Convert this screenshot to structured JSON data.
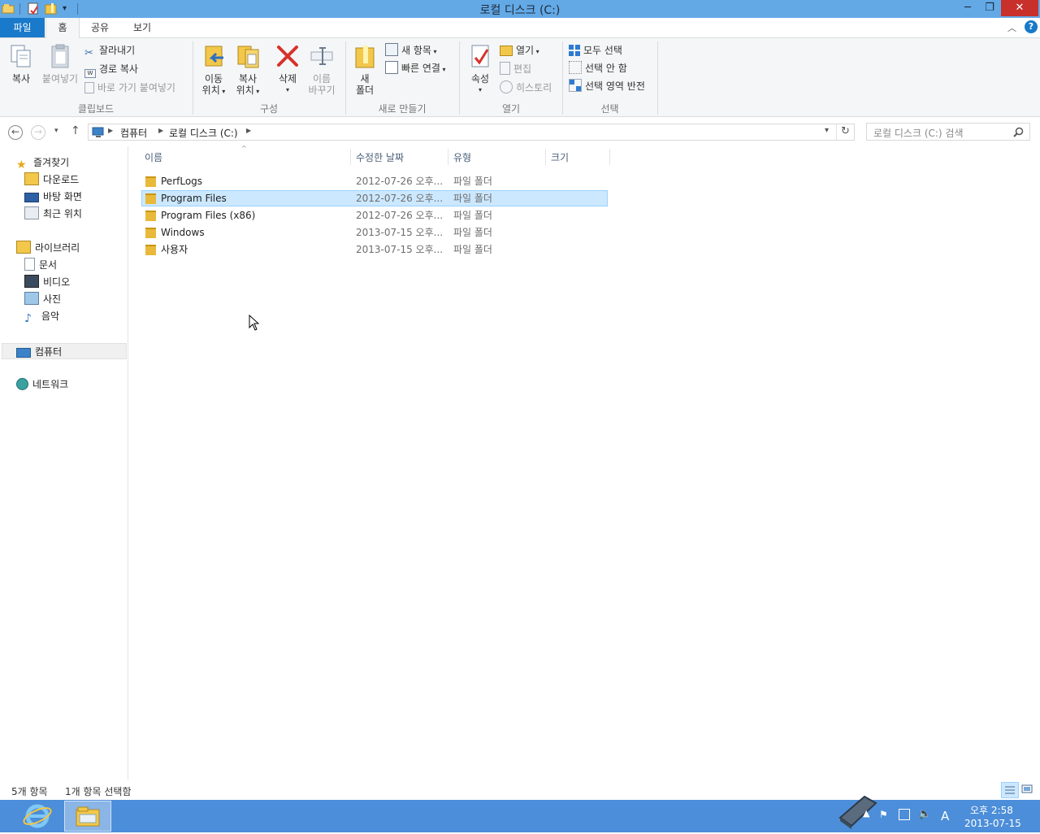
{
  "window": {
    "title": "로컬 디스크 (C:)",
    "minimize": "─",
    "restore": "❐",
    "close": "✕"
  },
  "tabs": [
    "파일",
    "홈",
    "공유",
    "보기"
  ],
  "ribbon": {
    "clipboard": {
      "label": "클립보드",
      "copy": "복사",
      "paste": "붙여넣기",
      "cut": "잘라내기",
      "copy_path": "경로 복사",
      "paste_shortcut": "바로 가기 붙여넣기"
    },
    "organize": {
      "label": "구성",
      "move_to_1": "이동",
      "move_to_2": "위치",
      "copy_to_1": "복사",
      "copy_to_2": "위치",
      "delete": "삭제",
      "rename_1": "이름",
      "rename_2": "바꾸기"
    },
    "new": {
      "label": "새로 만들기",
      "new_folder_1": "새",
      "new_folder_2": "폴더",
      "new_item": "새 항목",
      "easy_access": "빠른 연결"
    },
    "open": {
      "label": "열기",
      "properties": "속성",
      "open": "열기",
      "edit": "편집",
      "history": "히스토리"
    },
    "select": {
      "label": "선택",
      "select_all": "모두 선택",
      "select_none": "선택 안 함",
      "invert": "선택 영역 반전"
    }
  },
  "address": {
    "crumbs": [
      "컴퓨터",
      "로컬 디스크 (C:)"
    ],
    "search_placeholder": "로컬 디스크 (C:) 검색"
  },
  "navpane": {
    "favorites": "즐겨찾기",
    "downloads": "다운로드",
    "desktop": "바탕 화면",
    "recent": "최근 위치",
    "libraries": "라이브러리",
    "documents": "문서",
    "videos": "비디오",
    "pictures": "사진",
    "music": "음악",
    "computer": "컴퓨터",
    "network": "네트워크"
  },
  "columns": {
    "name": "이름",
    "date": "수정한 날짜",
    "type": "유형",
    "size": "크기"
  },
  "files": [
    {
      "name": "PerfLogs",
      "date": "2012-07-26 오후...",
      "type": "파일 폴더"
    },
    {
      "name": "Program Files",
      "date": "2012-07-26 오후...",
      "type": "파일 폴더"
    },
    {
      "name": "Program Files (x86)",
      "date": "2012-07-26 오후...",
      "type": "파일 폴더"
    },
    {
      "name": "Windows",
      "date": "2013-07-15 오후...",
      "type": "파일 폴더"
    },
    {
      "name": "사용자",
      "date": "2013-07-15 오후...",
      "type": "파일 폴더"
    }
  ],
  "status": {
    "count": "5개 항목",
    "selected": "1개 항목 선택함"
  },
  "tray": {
    "time": "오후 2:58",
    "date": "2013-07-15",
    "ime": "A"
  },
  "colors": {
    "titlebar": "#63a9e6",
    "file_tab": "#1979ca",
    "selection": "#cce8ff",
    "taskbar": "#4c8ed9"
  }
}
